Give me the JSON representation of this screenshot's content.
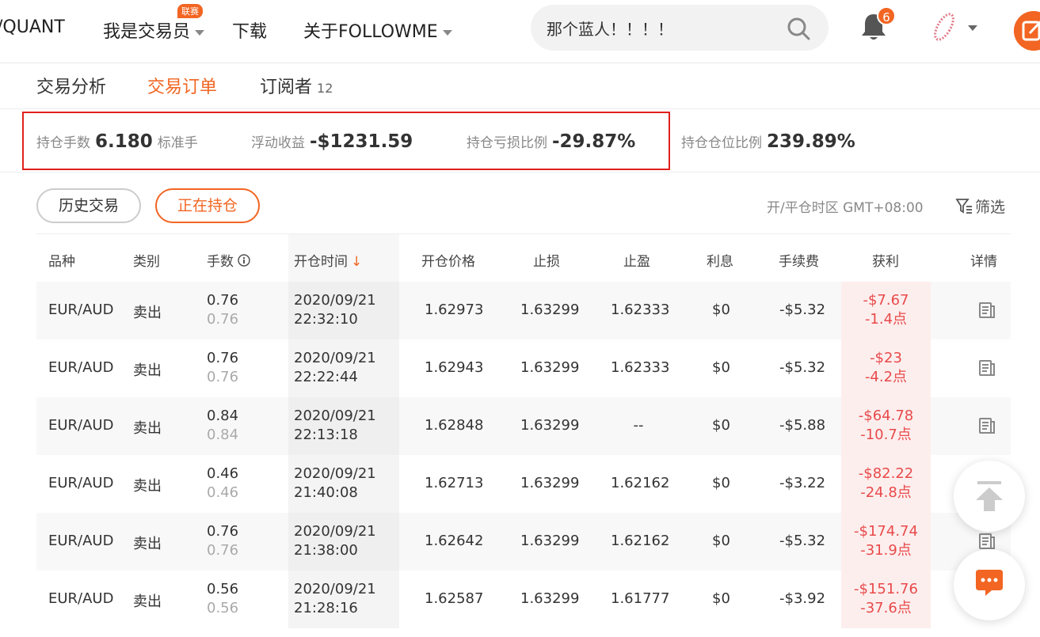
{
  "nav": {
    "items": [
      {
        "label": "/QUANT",
        "has_caret": false
      },
      {
        "label": "我是交易员",
        "has_caret": true
      },
      {
        "label": "下载",
        "has_caret": false
      },
      {
        "label": "关于FOLLOWME",
        "has_caret": true
      }
    ],
    "contest_badge": "联赛",
    "search_value": "那个蓝人！！！！",
    "notification_count": "6"
  },
  "tabs": [
    {
      "label": "交易分析",
      "active": false
    },
    {
      "label": "交易订单",
      "active": true
    },
    {
      "label": "订阅者",
      "count": "12",
      "active": false
    }
  ],
  "summary": {
    "lots_label": "持仓手数",
    "lots_value": "6.180",
    "lots_unit": "标准手",
    "float_label": "浮动收益",
    "float_value": "-$1231.59",
    "loss_ratio_label": "持仓亏损比例",
    "loss_ratio_value": "-29.87%",
    "position_ratio_label": "持仓仓位比例",
    "position_ratio_value": "239.89%"
  },
  "filters": {
    "history_label": "历史交易",
    "open_label": "正在持仓",
    "timezone": "开/平仓时区 GMT+08:00",
    "filter_label": "筛选"
  },
  "table": {
    "headers": {
      "symbol": "品种",
      "type": "类别",
      "lots": "手数",
      "open_time": "开仓时间",
      "open_price": "开仓价格",
      "stop_loss": "止损",
      "take_profit": "止盈",
      "interest": "利息",
      "fee": "手续费",
      "profit": "获利",
      "detail": "详情"
    },
    "rows": [
      {
        "symbol": "EUR/AUD",
        "type": "卖出",
        "lots": "0.76",
        "lots_sub": "0.76",
        "date": "2020/09/21",
        "time": "22:32:10",
        "open_price": "1.62973",
        "sl": "1.63299",
        "tp": "1.62333",
        "interest": "$0",
        "fee": "-$5.32",
        "profit": "-$7.67",
        "points": "-1.4点"
      },
      {
        "symbol": "EUR/AUD",
        "type": "卖出",
        "lots": "0.76",
        "lots_sub": "0.76",
        "date": "2020/09/21",
        "time": "22:22:44",
        "open_price": "1.62943",
        "sl": "1.63299",
        "tp": "1.62333",
        "interest": "$0",
        "fee": "-$5.32",
        "profit": "-$23",
        "points": "-4.2点"
      },
      {
        "symbol": "EUR/AUD",
        "type": "卖出",
        "lots": "0.84",
        "lots_sub": "0.84",
        "date": "2020/09/21",
        "time": "22:13:18",
        "open_price": "1.62848",
        "sl": "1.63299",
        "tp": "--",
        "interest": "$0",
        "fee": "-$5.88",
        "profit": "-$64.78",
        "points": "-10.7点"
      },
      {
        "symbol": "EUR/AUD",
        "type": "卖出",
        "lots": "0.46",
        "lots_sub": "0.46",
        "date": "2020/09/21",
        "time": "21:40:08",
        "open_price": "1.62713",
        "sl": "1.63299",
        "tp": "1.62162",
        "interest": "$0",
        "fee": "-$3.22",
        "profit": "-$82.22",
        "points": "-24.8点"
      },
      {
        "symbol": "EUR/AUD",
        "type": "卖出",
        "lots": "0.76",
        "lots_sub": "0.76",
        "date": "2020/09/21",
        "time": "21:38:00",
        "open_price": "1.62642",
        "sl": "1.63299",
        "tp": "1.62162",
        "interest": "$0",
        "fee": "-$5.32",
        "profit": "-$174.74",
        "points": "-31.9点"
      },
      {
        "symbol": "EUR/AUD",
        "type": "卖出",
        "lots": "0.56",
        "lots_sub": "0.56",
        "date": "2020/09/21",
        "time": "21:28:16",
        "open_price": "1.62587",
        "sl": "1.63299",
        "tp": "1.61777",
        "interest": "$0",
        "fee": "-$3.92",
        "profit": "-$151.76",
        "points": "-37.6点"
      }
    ]
  },
  "colors": {
    "accent": "#f26522",
    "loss": "#e84a4a",
    "highlight_border": "#e0201c"
  }
}
